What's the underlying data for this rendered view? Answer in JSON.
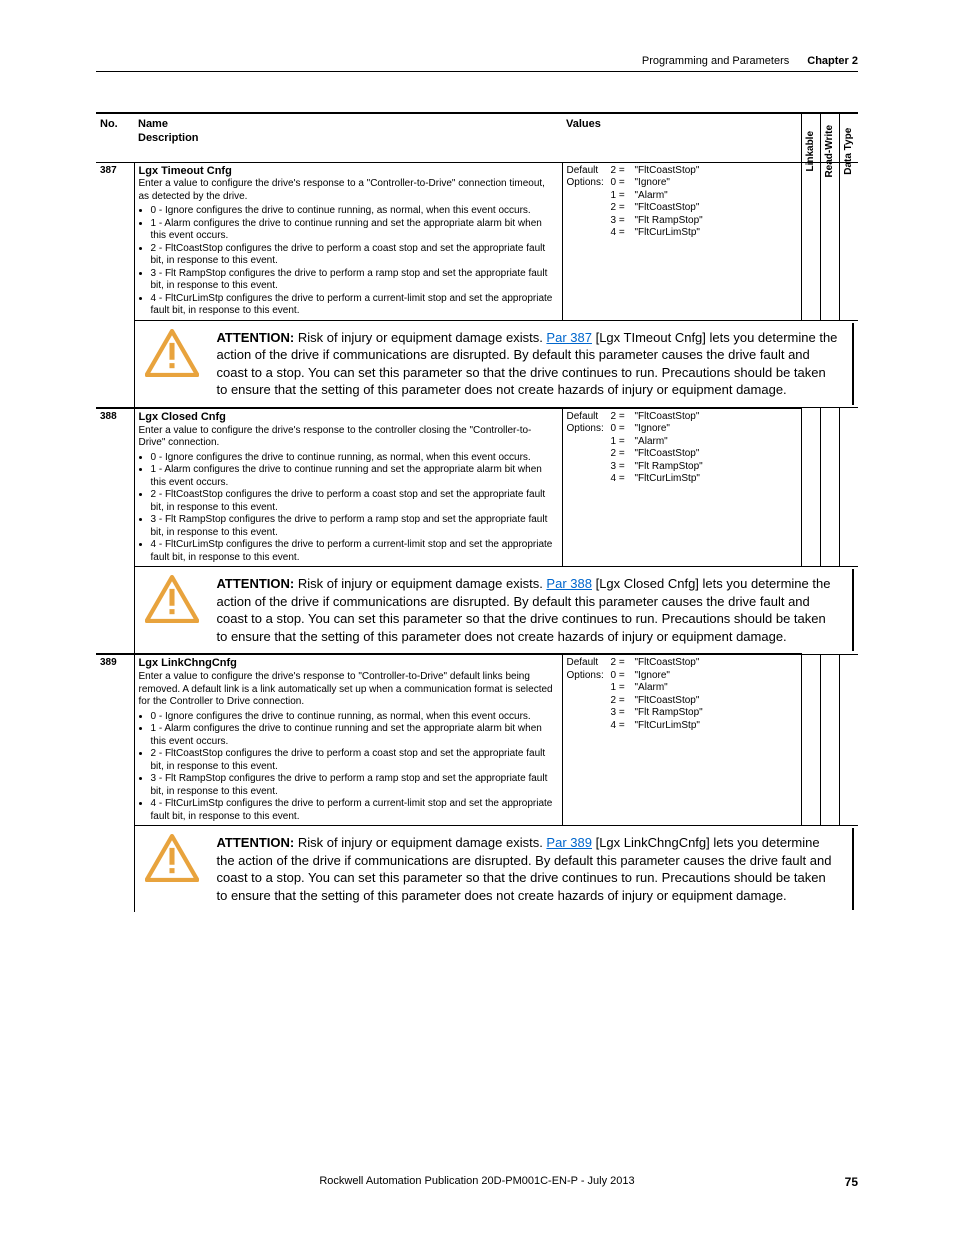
{
  "header": {
    "section": "Programming and Parameters",
    "chapter": "Chapter 2"
  },
  "table_head": {
    "no": "No.",
    "name": "Name",
    "description_label": "Description",
    "values": "Values",
    "rot": [
      "Linkable",
      "Read-Write",
      "Data Type"
    ]
  },
  "common": {
    "default_label": "Default",
    "options_label": "Options:",
    "default_line": [
      "2 =",
      "\"FltCoastStop\""
    ],
    "options": [
      [
        "0 =",
        "\"Ignore\""
      ],
      [
        "1 =",
        "\"Alarm\""
      ],
      [
        "2 =",
        "\"FltCoastStop\""
      ],
      [
        "3 =",
        "\"Flt RampStop\""
      ],
      [
        "4 =",
        "\"FltCurLimStp\""
      ]
    ],
    "bullets_core": [
      "0 - Ignore configures the drive to continue running, as normal, when this event occurs.",
      "1 - Alarm configures the drive to continue running and set the appropriate alarm bit when this event occurs.",
      "2 - FltCoastStop configures the drive to perform a coast stop and set the appropriate fault bit, in response to this event.",
      "3 - Flt RampStop configures the drive to perform a ramp stop and set the appropriate fault bit, in response to this event.",
      "4 - FltCurLimStp configures the drive to perform a current-limit stop and set the appropriate fault bit, in response to this event."
    ],
    "attn_prefix": "ATTENTION:",
    "attn_lead": " Risk of injury or equipment damage exists. ",
    "attn_body_tail": " lets you determine the action of the drive if communications are disrupted. By default this parameter causes the drive fault and coast to a stop. You can set this parameter so that the drive continues to run. Precautions should be taken to ensure that the setting of this parameter does not create hazards of injury or equipment damage."
  },
  "rows": [
    {
      "no": "387",
      "name": "Lgx Timeout Cnfg",
      "intro": "Enter a value to configure the drive's response to a \"Controller-to-Drive\" connection timeout, as detected by the drive.",
      "attn_link": "Par 387",
      "attn_bracket": " [Lgx TImeout Cnfg]"
    },
    {
      "no": "388",
      "name": "Lgx Closed Cnfg",
      "intro": "Enter a value to configure the drive's response to the controller closing the \"Controller-to-Drive\" connection.",
      "attn_link": "Par 388",
      "attn_bracket": " [Lgx Closed Cnfg]"
    },
    {
      "no": "389",
      "name": "Lgx LinkChngCnfg",
      "intro": "Enter a value to configure the drive's response to \"Controller-to-Drive\" default links being removed.  A default link is a link automatically set up when a communication format is selected for the Controller to Drive connection.",
      "attn_link": "Par 389",
      "attn_bracket": " [Lgx LinkChngCnfg]"
    }
  ],
  "footer": {
    "pub": "Rockwell Automation Publication 20D-PM001C-EN-P - July 2013",
    "page": "75"
  }
}
